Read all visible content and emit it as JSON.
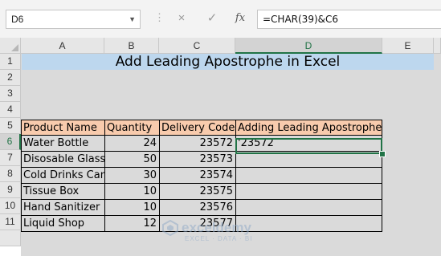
{
  "formula_bar": {
    "name_box": "D6",
    "formula": "=CHAR(39)&C6",
    "cancel_icon": "×",
    "enter_icon": "✓",
    "fx_label": "fx"
  },
  "columns": [
    "A",
    "B",
    "C",
    "D",
    "E"
  ],
  "rows": [
    "1",
    "2",
    "3",
    "4",
    "5",
    "6",
    "7",
    "8",
    "9",
    "10",
    "11",
    ""
  ],
  "sheet": {
    "title": "Add Leading Apostrophe in Excel",
    "headers": [
      "Product Name",
      "Quantity",
      "Delivery Code",
      "Adding Leading Apostrophe"
    ],
    "data": [
      [
        "Water Bottle",
        "24",
        "23572",
        "'23572"
      ],
      [
        "Disosable Glass",
        "50",
        "23573",
        ""
      ],
      [
        "Cold Drinks Can",
        "30",
        "23574",
        ""
      ],
      [
        "Tissue Box",
        "10",
        "23575",
        ""
      ],
      [
        "Hand Sanitizer",
        "10",
        "23576",
        ""
      ],
      [
        "Liquid Shop",
        "12",
        "23577",
        ""
      ]
    ]
  },
  "watermark": {
    "name": "exceldemy",
    "tagline": "EXCEL · DATA · BI"
  },
  "colors": {
    "accent": "#217346",
    "title_fill": "#bdd7ee",
    "header_fill": "#f8cbad"
  }
}
